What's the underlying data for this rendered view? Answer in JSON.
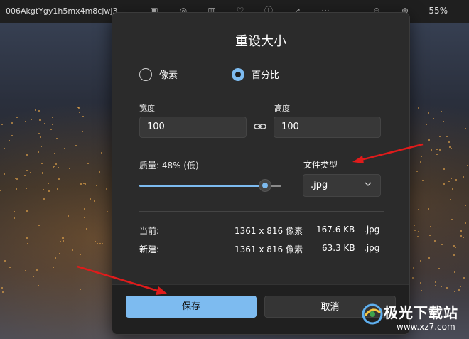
{
  "topbar": {
    "filename": "006AkgtYgy1h5mx4m8cjwj3",
    "zoom": "55%",
    "icons": [
      "image-edit-icon",
      "info-icon",
      "delete-icon",
      "heart-icon",
      "info-circle-icon",
      "share-icon",
      "more-icon",
      "zoom-out-icon",
      "zoom-in-icon"
    ]
  },
  "dialog": {
    "title": "重设大小",
    "mode": {
      "options": [
        {
          "label": "像素",
          "selected": false
        },
        {
          "label": "百分比",
          "selected": true
        }
      ]
    },
    "width": {
      "label": "宽度",
      "value": "100"
    },
    "height": {
      "label": "高度",
      "value": "100"
    },
    "quality": {
      "label": "质量: 48% (低)",
      "value": 48
    },
    "filetype": {
      "label": "文件类型",
      "value": ".jpg"
    },
    "current": {
      "label": "当前:",
      "dims": "1361 x 816 像素",
      "size": "167.6 KB",
      "type": ".jpg"
    },
    "new": {
      "label": "新建:",
      "dims": "1361 x 816 像素",
      "size": "63.3 KB",
      "type": ".jpg"
    },
    "buttons": {
      "save": "保存",
      "cancel": "取消"
    }
  },
  "watermark": {
    "name": "极光下载站",
    "url": "www.xz7.com"
  },
  "colors": {
    "accent": "#7dbbf0",
    "dialog_bg": "#2b2b2b",
    "arrow": "#e01b1b"
  }
}
